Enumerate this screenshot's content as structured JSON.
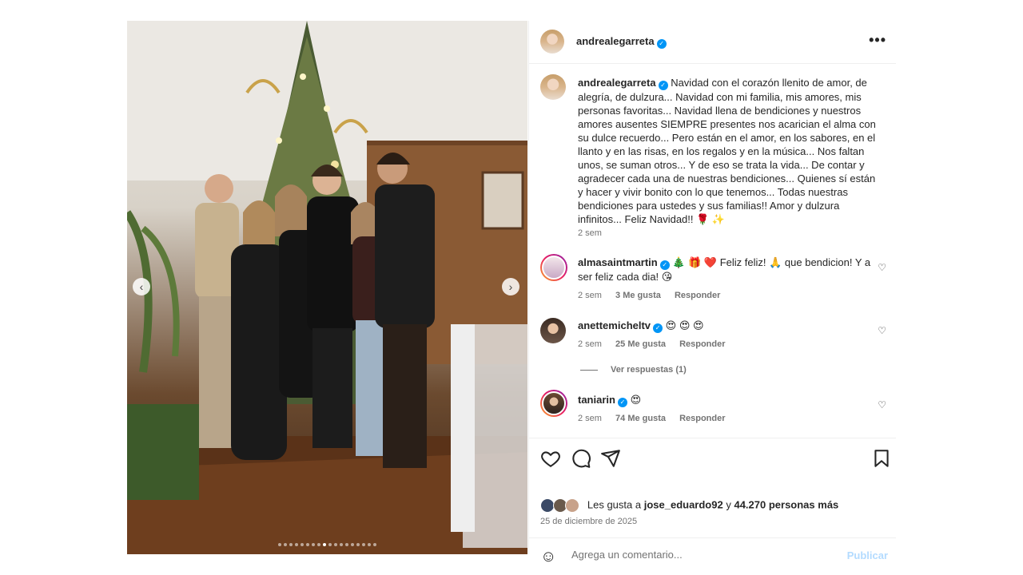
{
  "post": {
    "username": "andrealegarreta",
    "more_label": "•••",
    "caption": "Navidad con el corazón llenito de amor, de alegría, de dulzura... Navidad con mi familia, mis amores, mis personas favoritas... Navidad llena de bendiciones y nuestros amores ausentes SIEMPRE presentes nos acarician el alma con su dulce recuerdo... Pero están en el amor, en los sabores, en el llanto y en las risas, en los regalos y en la música... Nos faltan unos, se suman otros... Y de eso se trata la vida... De contar y agradecer cada una de nuestras bendiciones... Quienes sí están y hacer y vivir bonito con lo que tenemos... Todas nuestras bendiciones para ustedes y sus familias!! Amor y dulzura infinitos... Feliz Navidad!! 🌹 ✨",
    "caption_time": "2 sem"
  },
  "media": {
    "prev_arrow": "‹",
    "next_arrow": "›",
    "slide_count": 18,
    "active_slide": 9
  },
  "comments": [
    {
      "username": "almasaintmartin",
      "text": "🎄 🎁 ❤️ Feliz feliz! 🙏 que bendicion! Y a ser feliz cada dia! 😘",
      "time": "2 sem",
      "likes": "3 Me gusta",
      "reply": "Responder"
    },
    {
      "username": "anettemicheltv",
      "text": "😍 😍 😍",
      "time": "2 sem",
      "likes": "25 Me gusta",
      "reply": "Responder",
      "view_replies": "Ver respuestas (1)"
    },
    {
      "username": "taniarin",
      "text": "😍",
      "time": "2 sem",
      "likes": "74 Me gusta",
      "reply": "Responder"
    }
  ],
  "likes": {
    "prefix": "Les gusta a",
    "user": "jose_eduardo92",
    "middle": "y",
    "count": "44.270 personas más"
  },
  "date": "25 de diciembre de 2025",
  "comment_box": {
    "placeholder": "Agrega un comentario...",
    "publish": "Publicar"
  },
  "colors": {
    "verified": "#0095f6",
    "publish_disabled": "#b3dbff",
    "muted": "#737373"
  }
}
